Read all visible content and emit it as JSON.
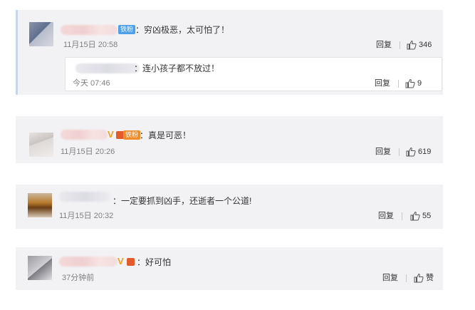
{
  "comments": [
    {
      "badge": "铁粉",
      "text": "：穷凶极恶，太可怕了！",
      "time": "11月15日 20:58",
      "reply_label": "回复",
      "like_count": "346",
      "subreply": {
        "text": "：连小孩子都不放过！",
        "time": "今天 07:46",
        "reply_label": "回复",
        "like_count": "9"
      }
    },
    {
      "v_mark": "V",
      "badge": "铁粉",
      "text": "：真是可恶！",
      "time": "11月15日 20:26",
      "reply_label": "回复",
      "like_count": "619"
    },
    {
      "text": "：一定要抓到凶手，还逝者一个公道!",
      "time": "11月15日 20:32",
      "reply_label": "回复",
      "like_count": "55"
    },
    {
      "v_mark": "V",
      "text": "：好可怕",
      "time": "37分钟前",
      "reply_label": "回复",
      "like_count": "赞"
    }
  ],
  "colors": {
    "card_bg": "#f2f2f5",
    "accent_border": "#c7d7ea",
    "badge_blue": "#4ea0e8",
    "badge_orange": "#f08c29",
    "v_gold": "#f0a020"
  },
  "icons": {
    "like": "thumbs-up-icon"
  }
}
